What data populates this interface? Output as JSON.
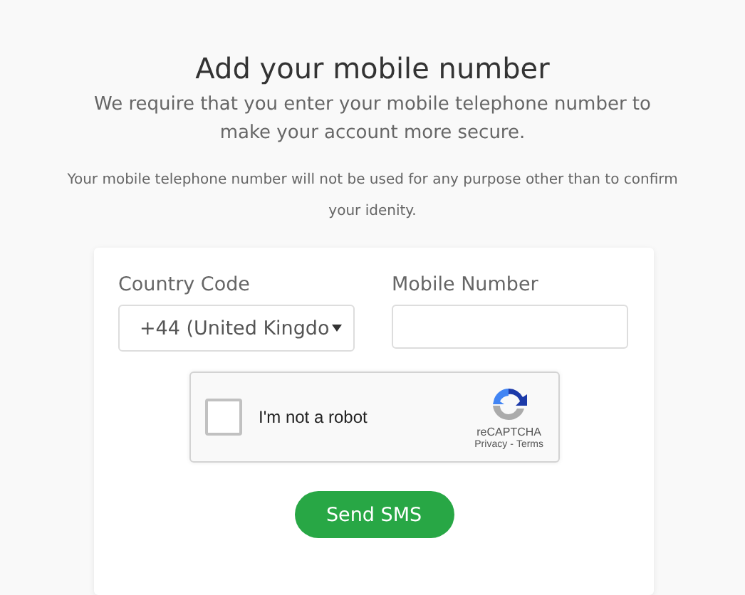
{
  "heading": "Add your mobile number",
  "intro": "We require that you enter your mobile telephone number to make your account more secure.",
  "note": "Your mobile telephone number will not be used for any purpose other than to confirm your idenity.",
  "form": {
    "country": {
      "label": "Country Code",
      "value": "+44 (United Kingdo"
    },
    "mobile": {
      "label": "Mobile Number"
    },
    "captcha": {
      "label": "I'm not a robot",
      "checked": false,
      "brand": "reCAPTCHA",
      "privacy": "Privacy",
      "separator": "-",
      "terms": "Terms"
    },
    "submit": "Send SMS"
  }
}
